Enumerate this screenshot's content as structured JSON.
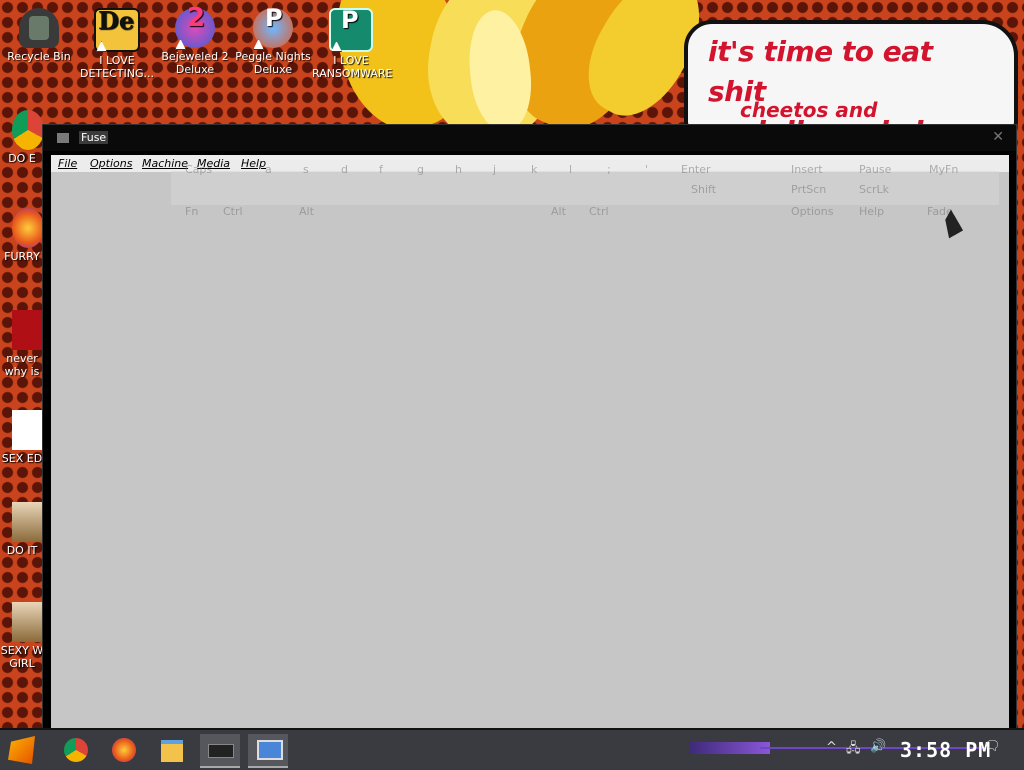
{
  "desktop": {
    "wallpaper_text_1": "it's time to eat shit\nand die and chew",
    "wallpaper_text_2": "cheetos and",
    "icons": [
      {
        "label": "Recycle Bin",
        "icon": "recycle-bin-icon"
      },
      {
        "label": "I LOVE DETECTING...",
        "icon": "de-app-icon"
      },
      {
        "label": "Bejeweled 2 Deluxe",
        "icon": "bejeweled-icon"
      },
      {
        "label": "Peggle Nights Deluxe",
        "icon": "peggle-icon"
      },
      {
        "label": "I LOVE RANSOMWARE",
        "icon": "publisher-icon"
      }
    ],
    "side_icons": [
      {
        "label": "DO E",
        "icon": "chrome-icon"
      },
      {
        "label": "FURRY",
        "icon": "firefox-icon"
      },
      {
        "label": "never why is",
        "icon": "dev-cpp-icon"
      },
      {
        "label": "SEX ED",
        "icon": "hex-editor-icon"
      },
      {
        "label": "DO IT",
        "icon": "portrait-icon"
      },
      {
        "label": "SEXY W GIRL",
        "icon": "portrait-icon"
      }
    ]
  },
  "window": {
    "title": "Fuse",
    "menu": [
      "File",
      "Options",
      "Machine",
      "Media",
      "Help"
    ]
  },
  "keyboard_overlay": {
    "row1": [
      "Caps",
      "a",
      "s",
      "d",
      "f",
      "g",
      "h",
      "j",
      "k",
      "l",
      ";",
      "'",
      "Enter",
      "Insert",
      "Pause",
      "MyFn"
    ],
    "row2": [
      "Shift",
      "z",
      "x",
      "c",
      "v",
      "b",
      "n",
      "m",
      ",",
      ".",
      "/",
      "Shift",
      "PrtScn",
      "ScrLk"
    ],
    "row3": [
      "Fn",
      "Ctrl",
      "Alt",
      "Alt",
      "Ctrl",
      "Options",
      "Help",
      "Fade"
    ]
  },
  "taskbar": {
    "clock": "3:58 PM",
    "apps": [
      "start-icon",
      "chrome-icon",
      "firefox-icon",
      "file-explorer-icon",
      "fuse-icon",
      "remote-desktop-icon"
    ]
  },
  "colors": {
    "accent": "#6f46c8",
    "speech_text": "#d2142e",
    "client_bg": "#c6c6c6"
  }
}
